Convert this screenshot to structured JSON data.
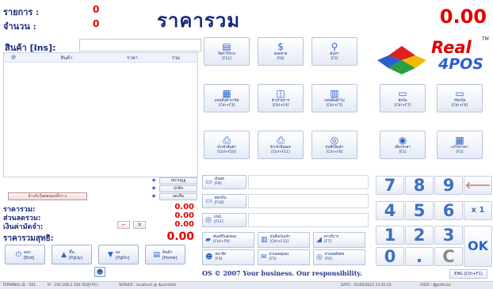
{
  "header": {
    "items_label": "รายการ :",
    "items_value": "0",
    "qty_label": "จำนวน :",
    "qty_value": "0",
    "title": "ราคารวม",
    "total": "0.00"
  },
  "product": {
    "label": "สินค้า [Ins]:",
    "input_value": "",
    "columns": [
      "@",
      "สินค้า",
      "ราคา",
      "รวม"
    ]
  },
  "side_buttons": [
    "หยวนมูลู",
    "ปกติล",
    "ลดเพิ่ม"
  ],
  "remove_button": "ล้างรับใบต่อของทั้งราว",
  "summary": {
    "subtotal_label": "ราคารวม:",
    "subtotal_value": "0.00",
    "discount_label": "ส่วนลดรวม:",
    "discount_value": "0.00",
    "deposit_label": "เงินค่ามัดจำ:",
    "deposit_value": "0.00",
    "net_label": "ราคารวมสุทธิ:",
    "net_value": "0.00",
    "minus_glyph": "−",
    "delete_glyph": "✕"
  },
  "nav_buttons": [
    {
      "label": "ออก\n[End]",
      "icon": "power-icon",
      "glyph": "⏻"
    },
    {
      "label": "ขึ้น\n[PgUp]",
      "icon": "arrow-up-icon",
      "glyph": "▲"
    },
    {
      "label": "ลง\n[PgDn]",
      "icon": "arrow-down-icon",
      "glyph": "▼"
    },
    {
      "label": "สินค้า\n[Home]",
      "icon": "document-icon",
      "glyph": "▤"
    }
  ],
  "person_glyph": "☻",
  "function_buttons": [
    {
      "label": "ปิดการขาย\n[F12]",
      "icon": "receipt-icon",
      "glyph": "▤"
    },
    {
      "label": "ยอดขาย\n[F8]",
      "icon": "money-icon",
      "glyph": "$"
    },
    {
      "label": "ค้นหา\n[F3]",
      "icon": "search-icon",
      "glyph": "⚲"
    },
    {
      "label": "แทนสินค้าบาร์ค\n[Ctrl+F3]",
      "icon": "list-icon",
      "glyph": "▦"
    },
    {
      "label": "ล้างรายการ\n[Ctrl+F4]",
      "icon": "cup-icon",
      "glyph": "◫"
    },
    {
      "label": "แทนสินค้าไม่\n[Ctrl+F5]",
      "icon": "book-icon",
      "glyph": "▥"
    },
    {
      "label": "พักบิล\n[Ctrl+F7]",
      "icon": "folder-icon",
      "glyph": "▭"
    },
    {
      "label": "เรียกบิล\n[Ctrl+F8]",
      "icon": "open-folder-icon",
      "glyph": "▭"
    },
    {
      "label": "นำเข้าสินค้า\n[Ctrl+F10]",
      "icon": "printer-icon",
      "glyph": "⎙"
    },
    {
      "label": "นำเข้าสินออก\n[Ctrl+F11]",
      "icon": "printer-out-icon",
      "glyph": "⎙"
    },
    {
      "label": "บันทึกสินค้า\n[Ctrl+F6]",
      "icon": "save-icon",
      "glyph": "◎"
    },
    {
      "label": "เลือกราคา\n[F1]",
      "icon": "price-icon",
      "glyph": "◉"
    },
    {
      "label": "แก้ไขราคา\n[F2]",
      "icon": "calculator-icon",
      "glyph": "▦"
    }
  ],
  "payment_buttons": [
    {
      "label": "เงินสด\n[F9]",
      "icon": "cash-icon",
      "glyph": "▭"
    },
    {
      "label": "บัตรเงิน\n[F10]",
      "icon": "card-icon",
      "glyph": "▭"
    },
    {
      "label": "USD\n[F11]",
      "icon": "usd-icon",
      "glyph": "◎"
    }
  ],
  "small_buttons": [
    {
      "label": "ต้นฟรีใบส่งของ\n[Ctrl+F9]",
      "icon": "truck-icon",
      "glyph": "▰"
    },
    {
      "label": "บันทึกเงินเข้า\n[Ctrl+F12]",
      "icon": "book-icon",
      "glyph": "▥"
    },
    {
      "label": "ค่าบริการ\n[F7]",
      "icon": "car-icon",
      "glyph": "◢"
    },
    {
      "label": "สมาชิก\n[F4]",
      "icon": "member-icon",
      "glyph": "☻"
    },
    {
      "label": "ส่วนลดคูปอง\n[F5]",
      "icon": "coupon-icon",
      "glyph": "✉"
    },
    {
      "label": "ส่วนลดพิเศษ\n[F6]",
      "icon": "discount-icon",
      "glyph": "◎"
    }
  ],
  "marquee": "OS © 2007 Your business. Our responsibility.",
  "keypad": [
    "7",
    "8",
    "9",
    "4",
    "5",
    "6",
    "1",
    "2",
    "3",
    "0",
    ".",
    "C"
  ],
  "keypad_back_glyph": "🡐",
  "keypad_x1": "x 1",
  "keypad_ok": "OK",
  "eng_button": "ENG [Ctrl+F1]",
  "logo": {
    "real": "Real",
    "fourpos": "4POS",
    "tm": "TM"
  },
  "status": {
    "terminal": "TERMINAL ID : 001",
    "ip": "IP : 192.168.1.104 (RUJY-PC)",
    "server": "SERVER : localhost @ 4posretail",
    "date": "DATE : 01/06/2022  12:02:33",
    "user": "USER : ผู้ดูแลระบบ"
  }
}
